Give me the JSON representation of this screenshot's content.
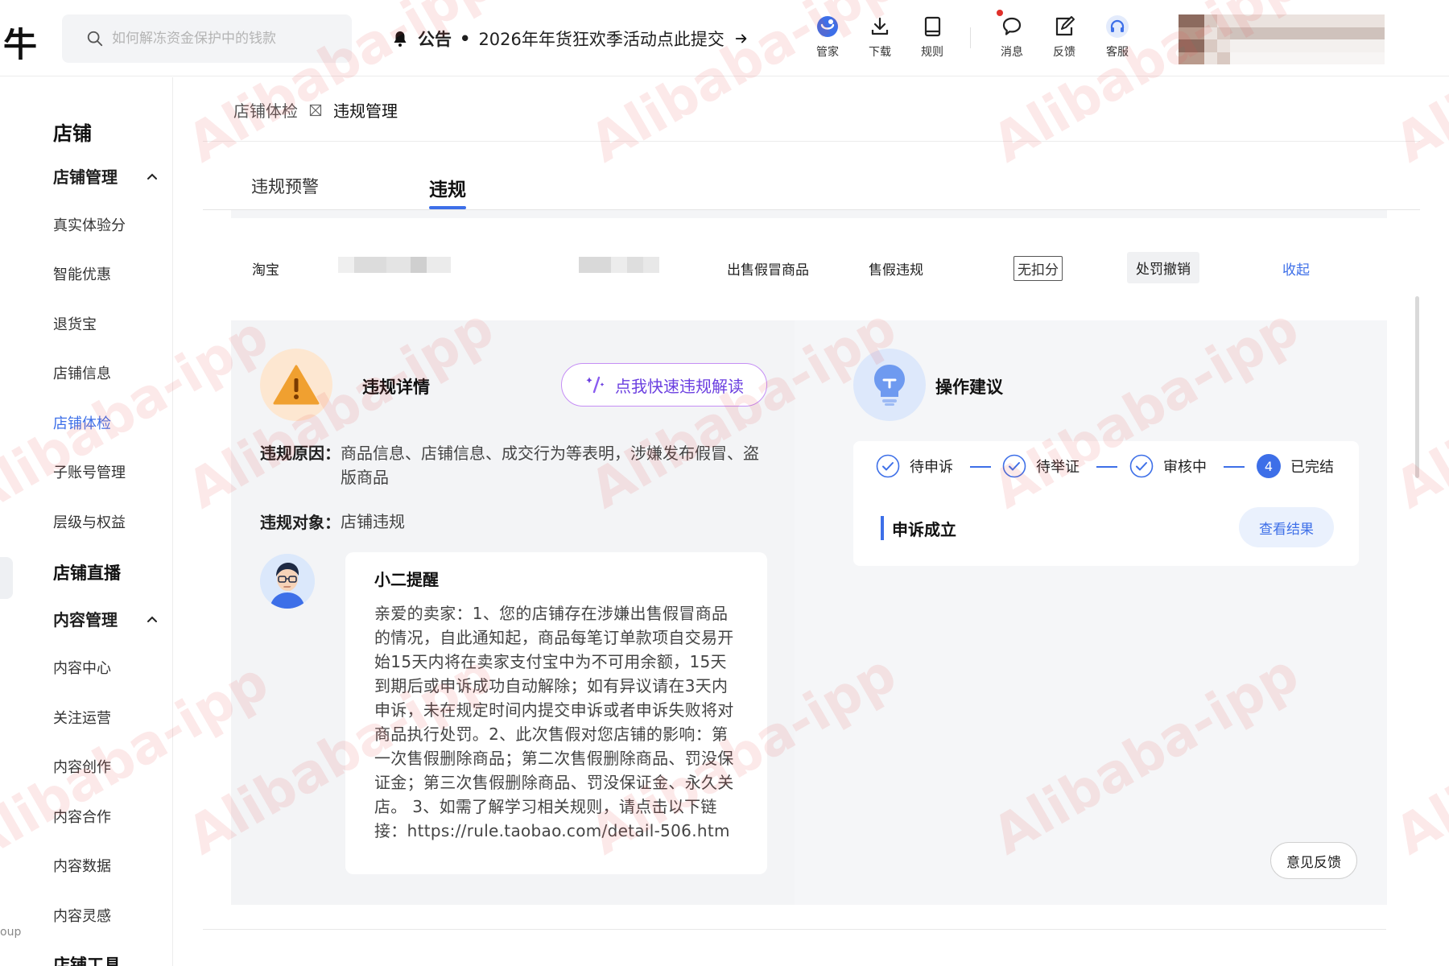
{
  "app": {
    "logo_char": "牛"
  },
  "search": {
    "placeholder": "如何解冻资金保护中的钱款",
    "value": ""
  },
  "notice": {
    "label": "公告",
    "dot": "•",
    "text": "2026年年货狂欢季活动点此提交"
  },
  "toolbar": {
    "butler": "管家",
    "download": "下载",
    "rules": "规则",
    "messages": "消息",
    "feedback": "反馈",
    "service": "客服"
  },
  "sidebar": {
    "group_store": "店铺",
    "sub_store_mgmt": "店铺管理",
    "items_store": [
      "真实体验分",
      "智能优惠",
      "退货宝",
      "店铺信息",
      "店铺体检",
      "子账号管理",
      "层级与权益"
    ],
    "group_live": "店铺直播",
    "sub_content_mgmt": "内容管理",
    "items_content": [
      "内容中心",
      "关注运营",
      "内容创作",
      "内容合作",
      "内容数据",
      "内容灵感"
    ],
    "group_tools": "店铺工具",
    "side_fragment": "oup"
  },
  "breadcrumb": {
    "parent": "店铺体检",
    "current": "违规管理"
  },
  "tabs": [
    {
      "label": "违规预警"
    },
    {
      "label": "违规"
    }
  ],
  "violation_row": {
    "platform": "淘宝",
    "type": "出售假冒商品",
    "category": "售假违规",
    "deduct_tag": "无扣分",
    "penalty_tag": "处罚撤销",
    "collapse": "收起"
  },
  "detail": {
    "title": "违规详情",
    "ai_button": "点我快速违规解读",
    "reason_label": "违规原因：",
    "reason_text": "商品信息、店铺信息、成交行为等表明，涉嫌发布假冒、盗版商品",
    "target_label": "违规对象：",
    "target_text": "店铺违规",
    "reminder_title": "小二提醒",
    "reminder_body": "亲爱的卖家：1、您的店铺存在涉嫌出售假冒商品的情况，自此通知起，商品每笔订单款项自交易开始15天内将在卖家支付宝中为不可用余额，15天到期后或申诉成功自动解除；如有异议请在3天内申诉，未在规定时间内提交申诉或者申诉失败将对商品执行处罚。2、此次售假对您店铺的影响：第一次售假删除商品；第二次售假删除商品、罚没保证金；第三次售假删除商品、罚没保证金、永久关店。 3、如需了解学习相关规则，请点击以下链接：https://rule.taobao.com/detail-506.htm"
  },
  "advice": {
    "title": "操作建议",
    "steps": [
      {
        "label": "待申诉",
        "state": "done"
      },
      {
        "label": "待举证",
        "state": "done"
      },
      {
        "label": "审核中",
        "state": "done"
      },
      {
        "label": "已完结",
        "state": "current",
        "num": "4"
      }
    ],
    "result_title": "申诉成立",
    "view_button": "查看结果"
  },
  "feedback_button": "意见反馈",
  "watermark": "Alibaba-ipp",
  "colors": {
    "accent": "#3d6fe8",
    "warn": "#f0a030",
    "ai_border": "#c58ef5",
    "ai_text": "#6b3fe0"
  }
}
